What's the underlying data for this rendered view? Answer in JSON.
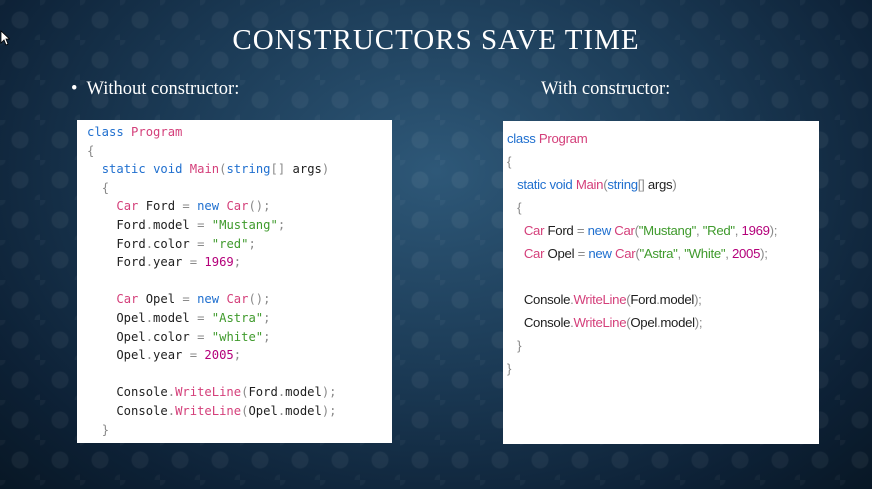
{
  "slide": {
    "title": "CONSTRUCTORS SAVE TIME",
    "left_heading": "Without constructor:",
    "right_heading": "With constructor:",
    "bullet": "•"
  },
  "colors": {
    "keyword": "#1f6fcf",
    "type": "#d43f7a",
    "string": "#3f9a2c",
    "number": "#b4007a",
    "punctuation": "#8a8a8a",
    "text": "#1e1e1e"
  },
  "left_code": [
    [
      [
        "kw",
        "class"
      ],
      [
        "txt",
        " "
      ],
      [
        "type",
        "Program"
      ]
    ],
    [
      [
        "pun",
        "{"
      ]
    ],
    [
      [
        "txt",
        "  "
      ],
      [
        "kw",
        "static"
      ],
      [
        "txt",
        " "
      ],
      [
        "kw",
        "void"
      ],
      [
        "txt",
        " "
      ],
      [
        "type",
        "Main"
      ],
      [
        "pun",
        "("
      ],
      [
        "kw",
        "string"
      ],
      [
        "pun",
        "[]"
      ],
      [
        "txt",
        " args"
      ],
      [
        "pun",
        ")"
      ]
    ],
    [
      [
        "txt",
        "  "
      ],
      [
        "pun",
        "{"
      ]
    ],
    [
      [
        "txt",
        "    "
      ],
      [
        "type",
        "Car"
      ],
      [
        "txt",
        " Ford "
      ],
      [
        "pun",
        "="
      ],
      [
        "txt",
        " "
      ],
      [
        "kw",
        "new"
      ],
      [
        "txt",
        " "
      ],
      [
        "type",
        "Car"
      ],
      [
        "pun",
        "();"
      ]
    ],
    [
      [
        "txt",
        "    Ford"
      ],
      [
        "pun",
        "."
      ],
      [
        "txt",
        "model "
      ],
      [
        "pun",
        "="
      ],
      [
        "txt",
        " "
      ],
      [
        "str",
        "\"Mustang\""
      ],
      [
        "pun",
        ";"
      ]
    ],
    [
      [
        "txt",
        "    Ford"
      ],
      [
        "pun",
        "."
      ],
      [
        "txt",
        "color "
      ],
      [
        "pun",
        "="
      ],
      [
        "txt",
        " "
      ],
      [
        "str",
        "\"red\""
      ],
      [
        "pun",
        ";"
      ]
    ],
    [
      [
        "txt",
        "    Ford"
      ],
      [
        "pun",
        "."
      ],
      [
        "txt",
        "year "
      ],
      [
        "pun",
        "="
      ],
      [
        "txt",
        " "
      ],
      [
        "num",
        "1969"
      ],
      [
        "pun",
        ";"
      ]
    ],
    [],
    [
      [
        "txt",
        "    "
      ],
      [
        "type",
        "Car"
      ],
      [
        "txt",
        " Opel "
      ],
      [
        "pun",
        "="
      ],
      [
        "txt",
        " "
      ],
      [
        "kw",
        "new"
      ],
      [
        "txt",
        " "
      ],
      [
        "type",
        "Car"
      ],
      [
        "pun",
        "();"
      ]
    ],
    [
      [
        "txt",
        "    Opel"
      ],
      [
        "pun",
        "."
      ],
      [
        "txt",
        "model "
      ],
      [
        "pun",
        "="
      ],
      [
        "txt",
        " "
      ],
      [
        "str",
        "\"Astra\""
      ],
      [
        "pun",
        ";"
      ]
    ],
    [
      [
        "txt",
        "    Opel"
      ],
      [
        "pun",
        "."
      ],
      [
        "txt",
        "color "
      ],
      [
        "pun",
        "="
      ],
      [
        "txt",
        " "
      ],
      [
        "str",
        "\"white\""
      ],
      [
        "pun",
        ";"
      ]
    ],
    [
      [
        "txt",
        "    Opel"
      ],
      [
        "pun",
        "."
      ],
      [
        "txt",
        "year "
      ],
      [
        "pun",
        "="
      ],
      [
        "txt",
        " "
      ],
      [
        "num",
        "2005"
      ],
      [
        "pun",
        ";"
      ]
    ],
    [],
    [
      [
        "txt",
        "    Console"
      ],
      [
        "pun",
        "."
      ],
      [
        "type",
        "WriteLine"
      ],
      [
        "pun",
        "("
      ],
      [
        "txt",
        "Ford"
      ],
      [
        "pun",
        "."
      ],
      [
        "txt",
        "model"
      ],
      [
        "pun",
        ");"
      ]
    ],
    [
      [
        "txt",
        "    Console"
      ],
      [
        "pun",
        "."
      ],
      [
        "type",
        "WriteLine"
      ],
      [
        "pun",
        "("
      ],
      [
        "txt",
        "Opel"
      ],
      [
        "pun",
        "."
      ],
      [
        "txt",
        "model"
      ],
      [
        "pun",
        ");"
      ]
    ],
    [
      [
        "txt",
        "  "
      ],
      [
        "pun",
        "}"
      ]
    ]
  ],
  "right_code": [
    [
      [
        "kw",
        "class"
      ],
      [
        "txt",
        " "
      ],
      [
        "type",
        "Program"
      ]
    ],
    [
      [
        "pun",
        "{"
      ]
    ],
    [
      [
        "txt",
        "   "
      ],
      [
        "kw",
        "static"
      ],
      [
        "txt",
        " "
      ],
      [
        "kw",
        "void"
      ],
      [
        "txt",
        " "
      ],
      [
        "type",
        "Main"
      ],
      [
        "pun",
        "("
      ],
      [
        "kw",
        "string"
      ],
      [
        "pun",
        "[]"
      ],
      [
        "txt",
        " args"
      ],
      [
        "pun",
        ")"
      ]
    ],
    [
      [
        "txt",
        "   "
      ],
      [
        "pun",
        "{"
      ]
    ],
    [
      [
        "txt",
        "     "
      ],
      [
        "type",
        "Car"
      ],
      [
        "txt",
        " Ford "
      ],
      [
        "pun",
        "="
      ],
      [
        "txt",
        " "
      ],
      [
        "kw",
        "new"
      ],
      [
        "txt",
        " "
      ],
      [
        "type",
        "Car"
      ],
      [
        "pun",
        "("
      ],
      [
        "str",
        "\"Mustang\""
      ],
      [
        "pun",
        ", "
      ],
      [
        "str",
        "\"Red\""
      ],
      [
        "pun",
        ", "
      ],
      [
        "num",
        "1969"
      ],
      [
        "pun",
        ");"
      ]
    ],
    [
      [
        "txt",
        "     "
      ],
      [
        "type",
        "Car"
      ],
      [
        "txt",
        " Opel "
      ],
      [
        "pun",
        "="
      ],
      [
        "txt",
        " "
      ],
      [
        "kw",
        "new"
      ],
      [
        "txt",
        " "
      ],
      [
        "type",
        "Car"
      ],
      [
        "pun",
        "("
      ],
      [
        "str",
        "\"Astra\""
      ],
      [
        "pun",
        ", "
      ],
      [
        "str",
        "\"White\""
      ],
      [
        "pun",
        ", "
      ],
      [
        "num",
        "2005"
      ],
      [
        "pun",
        ");"
      ]
    ],
    [],
    [
      [
        "txt",
        "     Console"
      ],
      [
        "pun",
        "."
      ],
      [
        "type",
        "WriteLine"
      ],
      [
        "pun",
        "("
      ],
      [
        "txt",
        "Ford"
      ],
      [
        "pun",
        "."
      ],
      [
        "txt",
        "model"
      ],
      [
        "pun",
        ");"
      ]
    ],
    [
      [
        "txt",
        "     Console"
      ],
      [
        "pun",
        "."
      ],
      [
        "type",
        "WriteLine"
      ],
      [
        "pun",
        "("
      ],
      [
        "txt",
        "Opel"
      ],
      [
        "pun",
        "."
      ],
      [
        "txt",
        "model"
      ],
      [
        "pun",
        ");"
      ]
    ],
    [
      [
        "txt",
        "   "
      ],
      [
        "pun",
        "}"
      ]
    ],
    [
      [
        "pun",
        "}"
      ]
    ]
  ]
}
